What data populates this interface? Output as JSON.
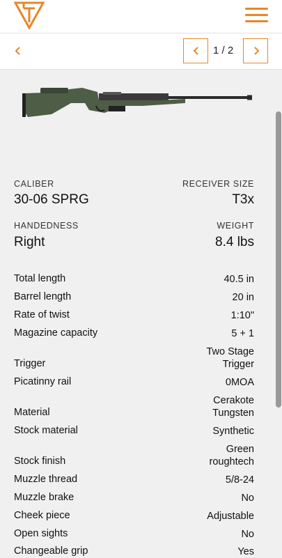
{
  "header": {
    "logo_icon": "tikka-logo-icon",
    "menu_icon": "hamburger-menu-icon",
    "accent": "#e8862a"
  },
  "pager": {
    "back_icon": "chevron-left-icon",
    "prev_icon": "chevron-left-icon",
    "next_icon": "chevron-right-icon",
    "text": "1 / 2"
  },
  "product": {
    "image": "rifle-image"
  },
  "specs": {
    "caliber_label": "CALIBER",
    "caliber_value": "30-06 SPRG",
    "receiver_label": "RECEIVER SIZE",
    "receiver_value": "T3x",
    "handedness_label": "HANDEDNESS",
    "handedness_value": "Right",
    "weight_label": "WEIGHT",
    "weight_value": "8.4 lbs"
  },
  "rows": [
    {
      "label": "Total length",
      "value": "40.5 in"
    },
    {
      "label": "Barrel length",
      "value": "20 in"
    },
    {
      "label": "Rate of twist",
      "value": "1:10\""
    },
    {
      "label": "Magazine capacity",
      "value": "5 + 1"
    },
    {
      "label": "Trigger",
      "value_line1": "Two Stage",
      "value_line2": "Trigger"
    },
    {
      "label": "Picatinny rail",
      "value": "0MOA"
    },
    {
      "label": "Material",
      "value_line1": "Cerakote",
      "value_line2": "Tungsten"
    },
    {
      "label": "Stock material",
      "value": "Synthetic"
    },
    {
      "label": "Stock finish",
      "value_line1": "Green",
      "value_line2": "roughtech"
    },
    {
      "label": "Muzzle thread",
      "value": "5/8-24"
    },
    {
      "label": "Muzzle brake",
      "value": "No"
    },
    {
      "label": "Cheek piece",
      "value": "Adjustable"
    },
    {
      "label": "Open sights",
      "value": "No"
    },
    {
      "label": "Changeable grip",
      "value": "Yes"
    }
  ]
}
